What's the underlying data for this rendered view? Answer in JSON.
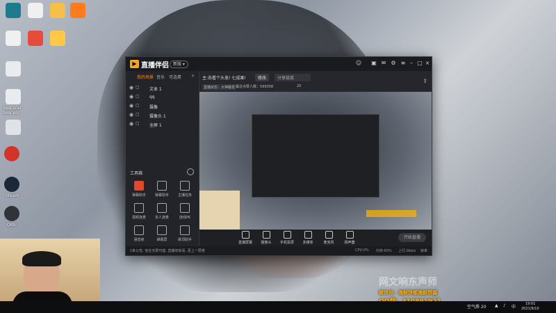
{
  "desktop": {
    "icons": [
      {
        "label": "Soqcscel Soqcels"
      },
      {
        "label": "Steam"
      },
      {
        "label": "OBS"
      }
    ]
  },
  "app": {
    "title": "直播伴侣",
    "version": "新版 ▾",
    "tabs": [
      "我的场景",
      "音乐",
      "可选素"
    ],
    "scenes": [
      "文本 1",
      "qq",
      "摄像",
      "摄像头 1",
      "全屏 1"
    ],
    "toolbox_label": "工具箱",
    "tools": [
      "弹幕助手",
      "弹幕助手",
      "主播任务",
      "视频连麦",
      "多人连麦",
      "连线PK",
      "语音房",
      "弹幕屏",
      "歌词助手"
    ],
    "top_fields": {
      "room": "主:去看个头发! 七成果!",
      "btn": "修改",
      "search": "分享链接"
    },
    "stats": {
      "label1": "直播状态：大神睡觉",
      "label2": "最近点赞人数：599358",
      "label3": "20"
    },
    "bottom_tools": [
      "直播屏幕",
      "摄像头",
      "手机投屏",
      "多媒体",
      "麦克风",
      "扬声器"
    ],
    "start_label": "开始直播",
    "status": {
      "left": "1条公告, 他在无限可能, 直播有惊喜, 更上一层楼",
      "cpu": "CPU:0%",
      "mem": "内存:65%",
      "net": "上行:0kb/s",
      "fps": "帧率"
    }
  },
  "overlay": {
    "line1": "微信号：海鲜饼都海鲜饼酱",
    "line2": "QQ群：310891921",
    "watermark": "网文响东声师"
  },
  "taskbar": {
    "weather": "空气质 20",
    "time": "19:01",
    "date": "2021/9/10"
  },
  "colors": {
    "accent": "#ff8a1c",
    "live": "#e0482c"
  }
}
